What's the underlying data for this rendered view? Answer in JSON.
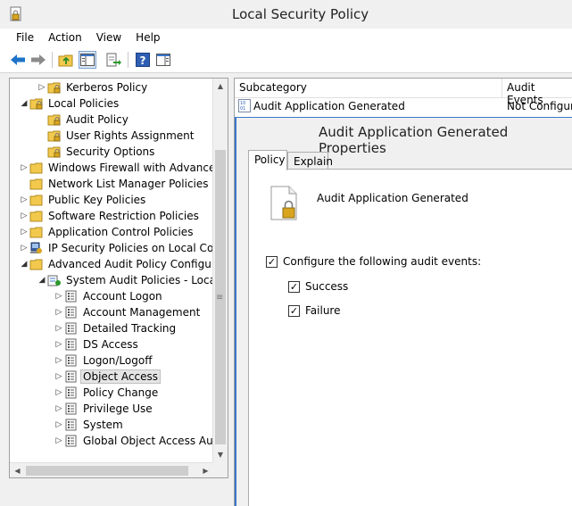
{
  "window": {
    "title": "Local Security Policy"
  },
  "menu": {
    "items": [
      "File",
      "Action",
      "View",
      "Help"
    ]
  },
  "tree": {
    "items": [
      {
        "label": "Kerberos Policy",
        "level": 2,
        "expander": "▷",
        "icon": "folder-lock-icon"
      },
      {
        "label": "Local Policies",
        "level": 1,
        "expander": "◢",
        "icon": "folder-lock-icon"
      },
      {
        "label": "Audit Policy",
        "level": 2,
        "expander": "",
        "icon": "folder-lock-icon"
      },
      {
        "label": "User Rights Assignment",
        "level": 2,
        "expander": "",
        "icon": "folder-lock-icon"
      },
      {
        "label": "Security Options",
        "level": 2,
        "expander": "",
        "icon": "folder-lock-icon"
      },
      {
        "label": "Windows Firewall with Advanced S",
        "level": 1,
        "expander": "▷",
        "icon": "folder-icon"
      },
      {
        "label": "Network List Manager Policies",
        "level": 1,
        "expander": "",
        "icon": "folder-icon"
      },
      {
        "label": "Public Key Policies",
        "level": 1,
        "expander": "▷",
        "icon": "folder-icon"
      },
      {
        "label": "Software Restriction Policies",
        "level": 1,
        "expander": "▷",
        "icon": "folder-icon"
      },
      {
        "label": "Application Control Policies",
        "level": 1,
        "expander": "▷",
        "icon": "folder-icon"
      },
      {
        "label": "IP Security Policies on Local Comp",
        "level": 1,
        "expander": "▷",
        "icon": "ip-security-icon"
      },
      {
        "label": "Advanced Audit Policy Configurat",
        "level": 1,
        "expander": "◢",
        "icon": "folder-icon"
      },
      {
        "label": "System Audit Policies - Local G",
        "level": 2,
        "expander": "◢",
        "icon": "audit-policy-icon"
      },
      {
        "label": "Account Logon",
        "level": 3,
        "expander": "▷",
        "icon": "audit-category-icon"
      },
      {
        "label": "Account Management",
        "level": 3,
        "expander": "▷",
        "icon": "audit-category-icon"
      },
      {
        "label": "Detailed Tracking",
        "level": 3,
        "expander": "▷",
        "icon": "audit-category-icon"
      },
      {
        "label": "DS Access",
        "level": 3,
        "expander": "▷",
        "icon": "audit-category-icon"
      },
      {
        "label": "Logon/Logoff",
        "level": 3,
        "expander": "▷",
        "icon": "audit-category-icon"
      },
      {
        "label": "Object Access",
        "level": 3,
        "expander": "▷",
        "icon": "audit-category-icon",
        "selected": true
      },
      {
        "label": "Policy Change",
        "level": 3,
        "expander": "▷",
        "icon": "audit-category-icon"
      },
      {
        "label": "Privilege Use",
        "level": 3,
        "expander": "▷",
        "icon": "audit-category-icon"
      },
      {
        "label": "System",
        "level": 3,
        "expander": "▷",
        "icon": "audit-category-icon"
      },
      {
        "label": "Global Object Access Audit",
        "level": 3,
        "expander": "▷",
        "icon": "audit-category-icon"
      }
    ]
  },
  "list": {
    "columns": [
      "Subcategory",
      "Audit Events"
    ],
    "rows": [
      {
        "subcategory": "Audit Application Generated",
        "audit_events": "Not Configure"
      }
    ]
  },
  "dialog": {
    "title": "Audit Application Generated Properties",
    "tabs": [
      "Policy",
      "Explain"
    ],
    "policy_name": "Audit Application Generated",
    "configure_label": "Configure the following audit events:",
    "configure_checked": true,
    "success_label": "Success",
    "success_checked": true,
    "failure_label": "Failure",
    "failure_checked": true
  },
  "colors": {
    "dialog_border": "#3a78c9",
    "folder": "#f3c94d",
    "arrow_blue": "#1e73c8"
  }
}
